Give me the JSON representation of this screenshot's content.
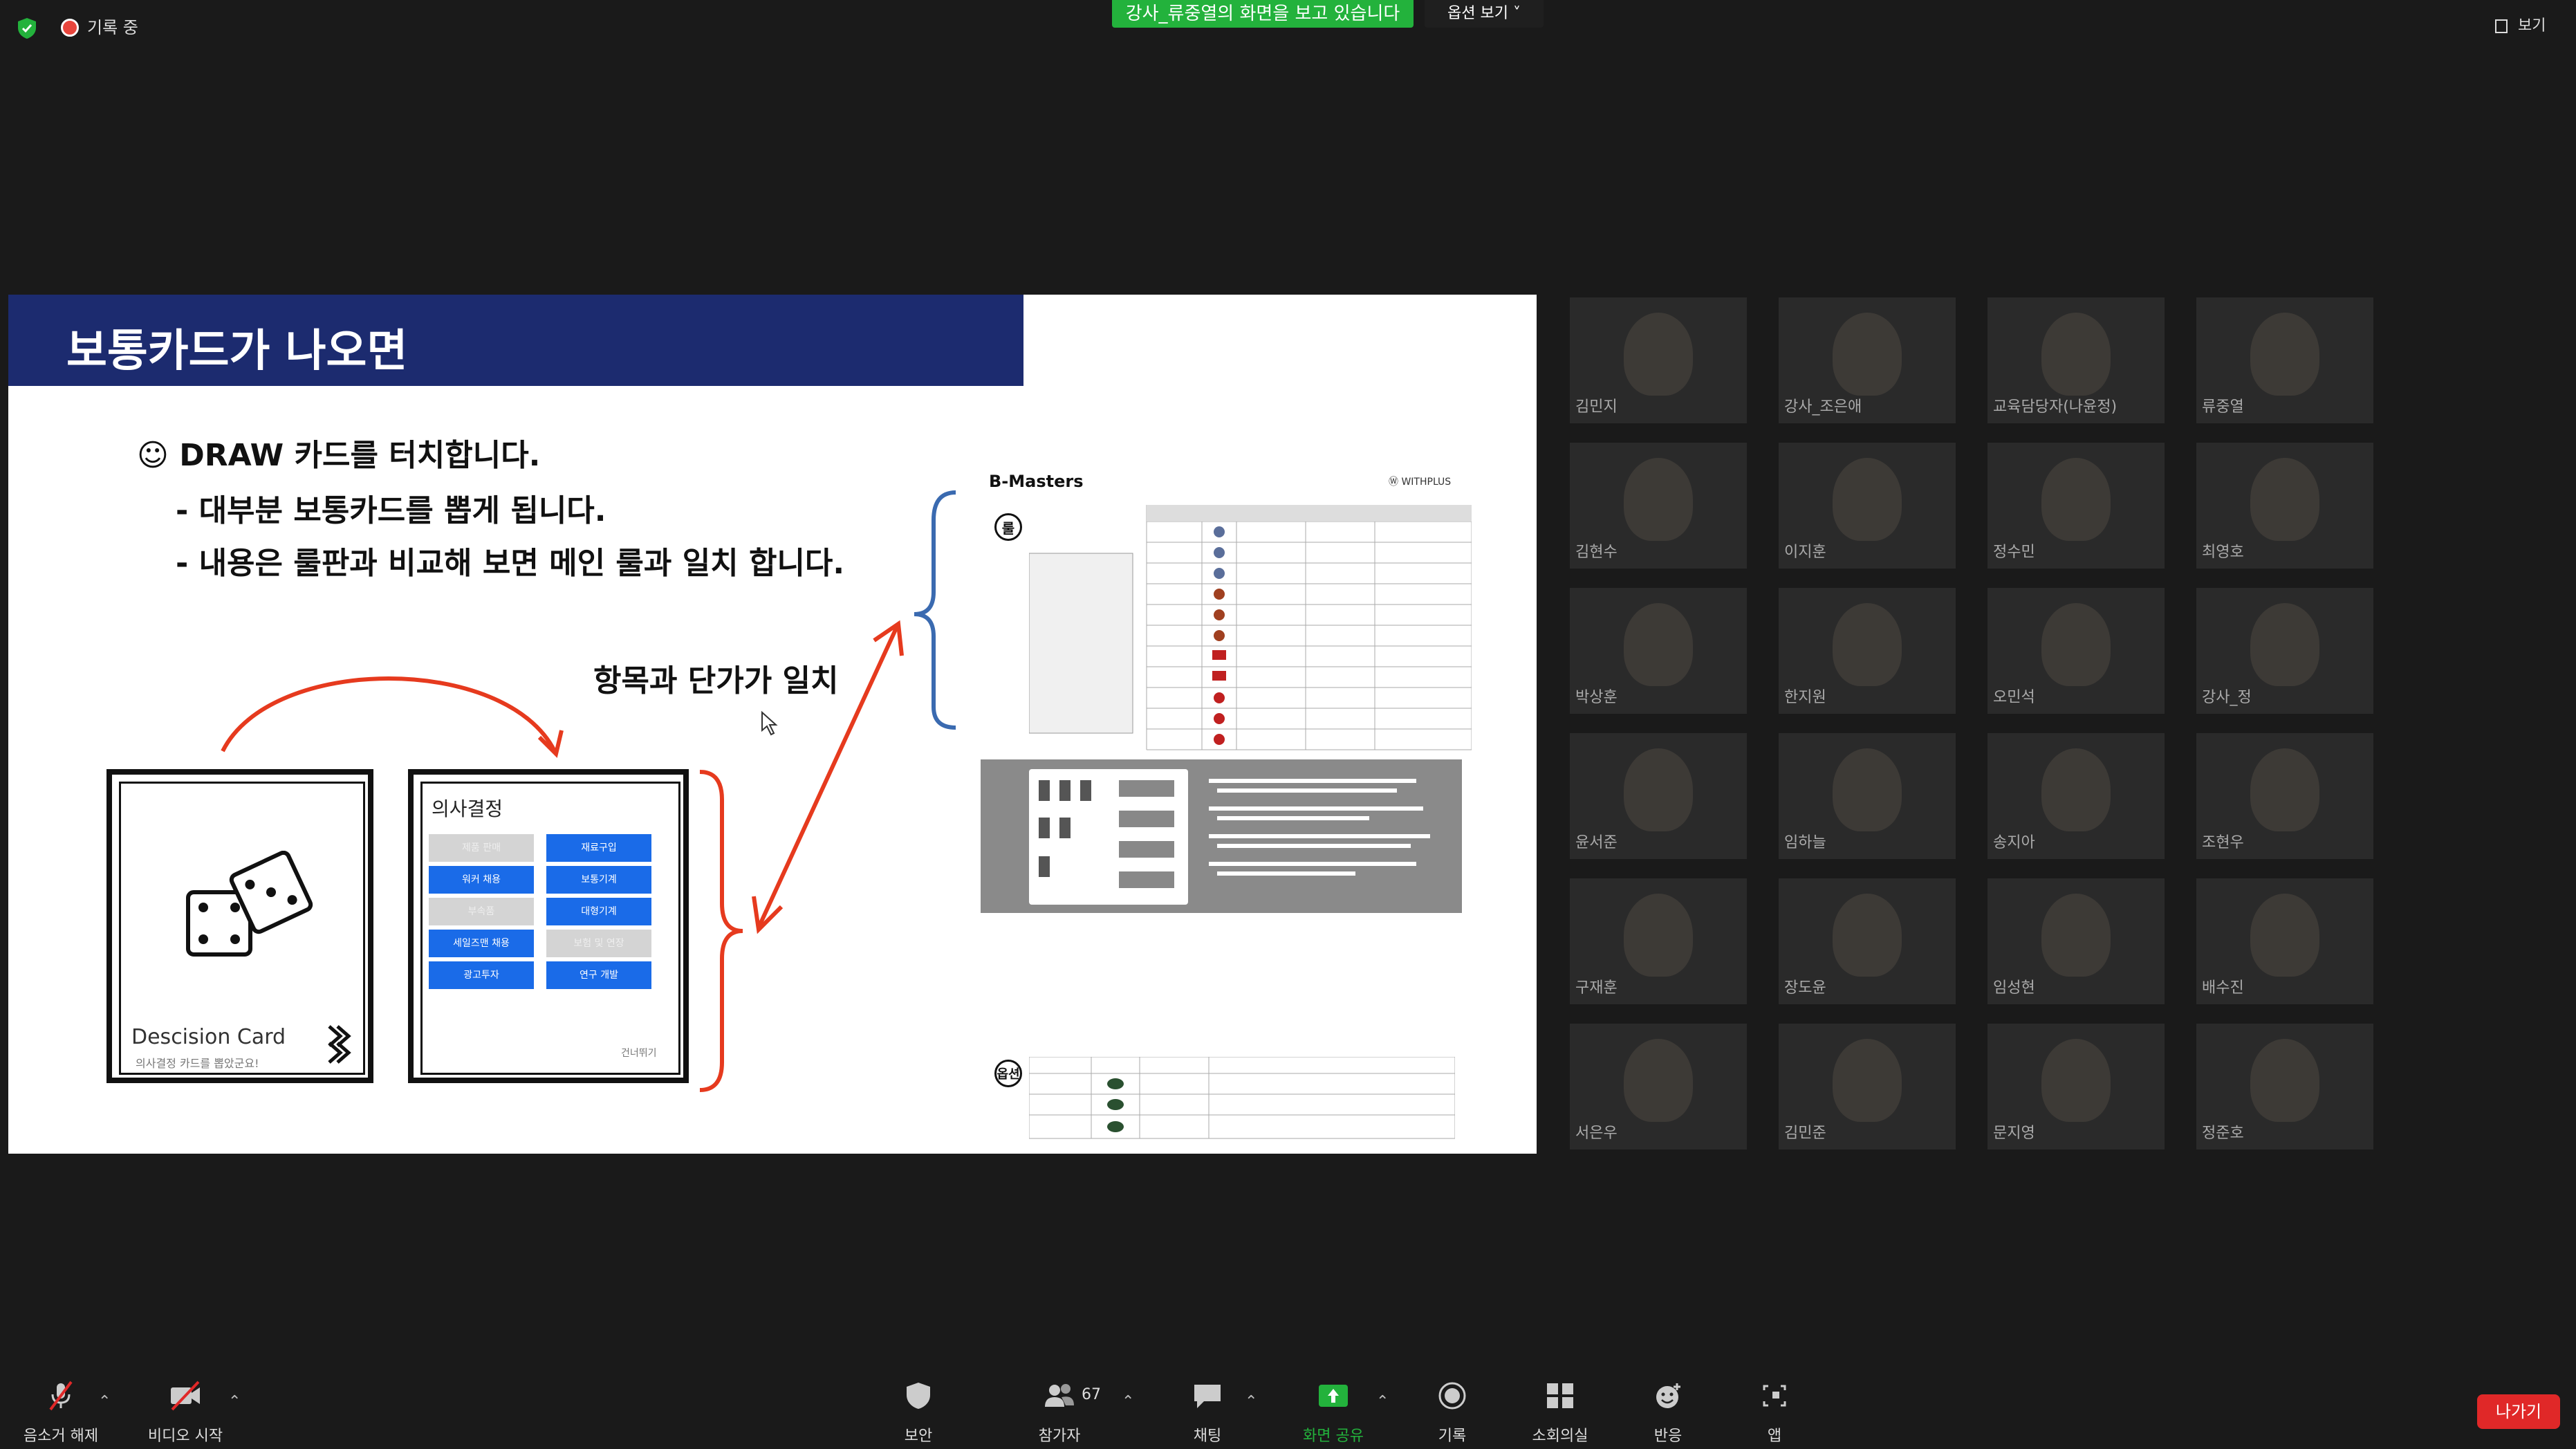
{
  "top": {
    "recording_label": "기록 중",
    "share_banner": "강사_류중열의 화면을 보고 있습니다",
    "options_label": "옵션 보기 ˅",
    "view_label": "보기"
  },
  "slide": {
    "title": "보통카드가 나오면",
    "bullets": [
      "☺ DRAW 카드를 터치합니다.",
      "- 대부분 보통카드를 뽑게 됩니다.",
      "- 내용은 룰판과 비교해 보면  메인 룰과 일치 합니다."
    ],
    "match_label": "항목과 단가가 일치",
    "dice_card": {
      "title": "Descision Card",
      "subtitle": "의사결정 카드를 뽑았군요!"
    },
    "decision_card": {
      "title": "의사결정",
      "buttons": [
        {
          "label": "제품 판매",
          "enabled": false
        },
        {
          "label": "재료구입",
          "enabled": true
        },
        {
          "label": "워커 채용",
          "enabled": true
        },
        {
          "label": "보통기계",
          "enabled": true
        },
        {
          "label": "부속품",
          "enabled": false
        },
        {
          "label": "대형기계",
          "enabled": true
        },
        {
          "label": "세일즈맨 채용",
          "enabled": true
        },
        {
          "label": "보험 및 연장",
          "enabled": false
        },
        {
          "label": "광고투자",
          "enabled": true
        },
        {
          "label": "연구 개발",
          "enabled": true
        }
      ],
      "footer": "건너뛰기"
    },
    "rule_board": {
      "logo": "B-Masters",
      "brand": "Ⓦ WITHPLUS",
      "main_tag": "룰",
      "option_tag": "옵션"
    }
  },
  "gallery": [
    "김민지",
    "강사_조은애",
    "교육담당자(나윤정)",
    "류중열",
    "김현수",
    "이지훈",
    "정수민",
    "최영호",
    "박상훈",
    "한지원",
    "오민석",
    "강사_정",
    "윤서준",
    "임하늘",
    "송지아",
    "조현우",
    "구재훈",
    "장도윤",
    "임성현",
    "배수진",
    "서은우",
    "김민준",
    "문지영",
    "정준호"
  ],
  "toolbar": [
    {
      "key": "mute",
      "label": "음소거 해제"
    },
    {
      "key": "video",
      "label": "비디오 시작"
    },
    {
      "key": "security",
      "label": "보안"
    },
    {
      "key": "participants",
      "label": "참가자",
      "count": "67"
    },
    {
      "key": "chat",
      "label": "채팅"
    },
    {
      "key": "share",
      "label": "화면 공유"
    },
    {
      "key": "record",
      "label": "기록"
    },
    {
      "key": "breakout",
      "label": "소회의실"
    },
    {
      "key": "reactions",
      "label": "반응"
    },
    {
      "key": "apps",
      "label": "앱"
    }
  ],
  "leave_label": "나가기",
  "colors": {
    "accent": "#23b23c",
    "slide_header": "#1c2b6f",
    "decision_blue": "#1a6be8",
    "leave_red": "#e02828"
  }
}
